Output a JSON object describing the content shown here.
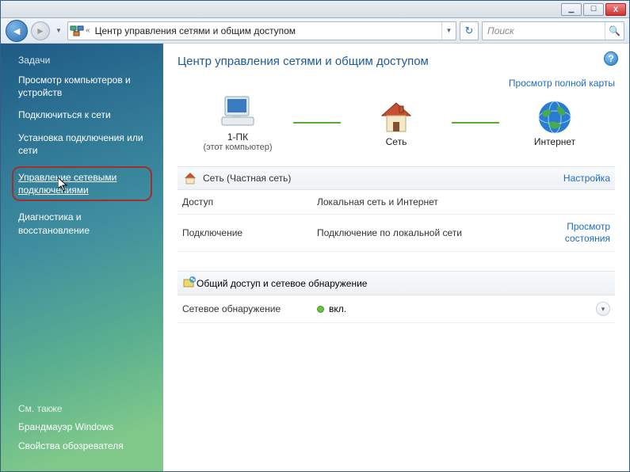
{
  "titlebar": {
    "min": "▁",
    "max": "☐",
    "close": "X"
  },
  "nav": {
    "address_icon": "⚙",
    "address": "Центр управления сетями и общим доступом",
    "refresh": "↻",
    "search_placeholder": "Поиск"
  },
  "sidebar": {
    "heading": "Задачи",
    "items": [
      "Просмотр компьютеров и устройств",
      "Подключиться к сети",
      "Установка подключения или сети",
      "Управление сетевыми подключениями",
      "Диагностика и восстановление"
    ],
    "see_also": "См. также",
    "bottom": [
      "Брандмауэр Windows",
      "Свойства обозревателя"
    ]
  },
  "main": {
    "title": "Центр управления сетями и общим доступом",
    "full_map": "Просмотр полной карты",
    "nodes": {
      "pc": {
        "label": "1-ПК",
        "sub": "(этот компьютер)"
      },
      "net": {
        "label": "Сеть"
      },
      "inet": {
        "label": "Интернет"
      }
    },
    "network_section": {
      "title": "Сеть (Частная сеть)",
      "config": "Настройка",
      "rows": [
        {
          "k": "Доступ",
          "v": "Локальная сеть и Интернет",
          "link": ""
        },
        {
          "k": "Подключение",
          "v": "Подключение по локальной сети",
          "link": "Просмотр состояния"
        }
      ]
    },
    "sharing_section": {
      "title": "Общий доступ и сетевое обнаружение",
      "row": {
        "k": "Сетевое обнаружение",
        "v": "вкл."
      }
    }
  }
}
